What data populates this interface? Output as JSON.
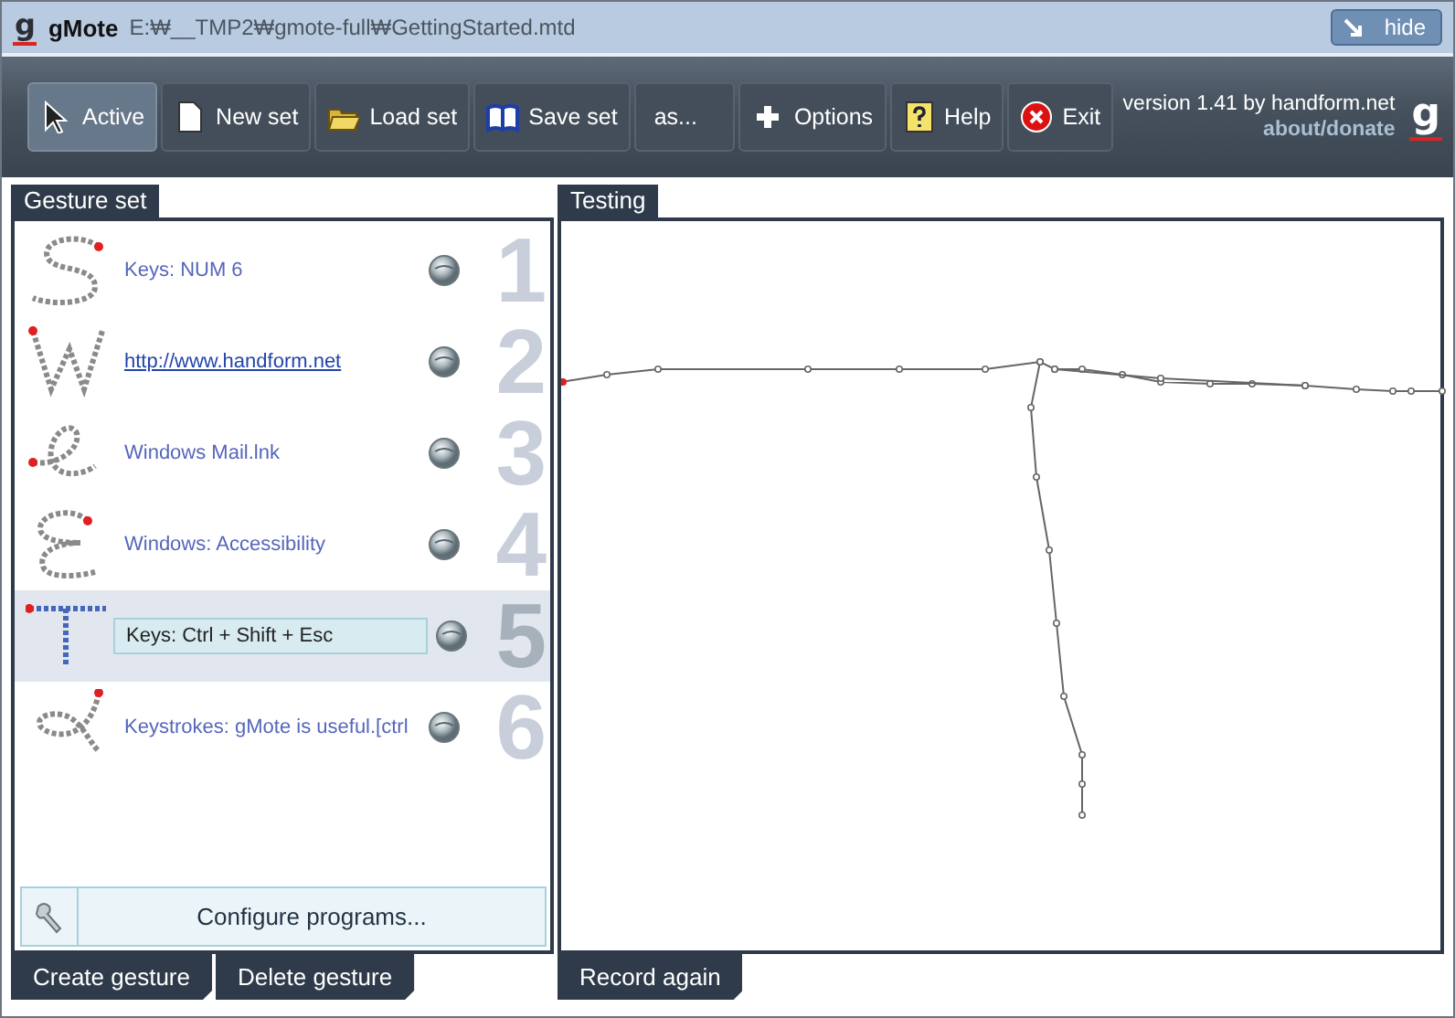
{
  "window": {
    "logo": "g",
    "title": "gMote",
    "file_path": "E:₩__TMP2₩gmote-full₩GettingStarted.mtd",
    "hide_button": "hide"
  },
  "toolbar": {
    "buttons": [
      {
        "label": "Active",
        "selected": true
      },
      {
        "label": "New set",
        "selected": false
      },
      {
        "label": "Load set",
        "selected": false
      },
      {
        "label": "Save set",
        "selected": false
      },
      {
        "label": "as...",
        "selected": false
      },
      {
        "label": "Options",
        "selected": false
      },
      {
        "label": "Help",
        "selected": false
      },
      {
        "label": "Exit",
        "selected": false
      }
    ],
    "version": "version 1.41 by handform.net",
    "about_link": "about/donate",
    "logo": "g"
  },
  "gesture_panel": {
    "tab": "Gesture set",
    "gestures": [
      {
        "number": "1",
        "action": "Keys: NUM 6",
        "kind": "text",
        "selected": false
      },
      {
        "number": "2",
        "action": "http://www.handform.net",
        "kind": "link",
        "selected": false
      },
      {
        "number": "3",
        "action": "Windows Mail.lnk",
        "kind": "text",
        "selected": false
      },
      {
        "number": "4",
        "action": "Windows: Accessibility",
        "kind": "text",
        "selected": false
      },
      {
        "number": "5",
        "action": "Keys: Ctrl + Shift + Esc",
        "kind": "text",
        "selected": true
      },
      {
        "number": "6",
        "action": "Keystrokes: gMote is useful.[ctrl",
        "kind": "text",
        "selected": false
      }
    ],
    "configure_button": "Configure programs..."
  },
  "testing_panel": {
    "tab": "Testing"
  },
  "actions": {
    "left": [
      "Create gesture",
      "Delete gesture"
    ],
    "right": [
      "Record again"
    ]
  }
}
